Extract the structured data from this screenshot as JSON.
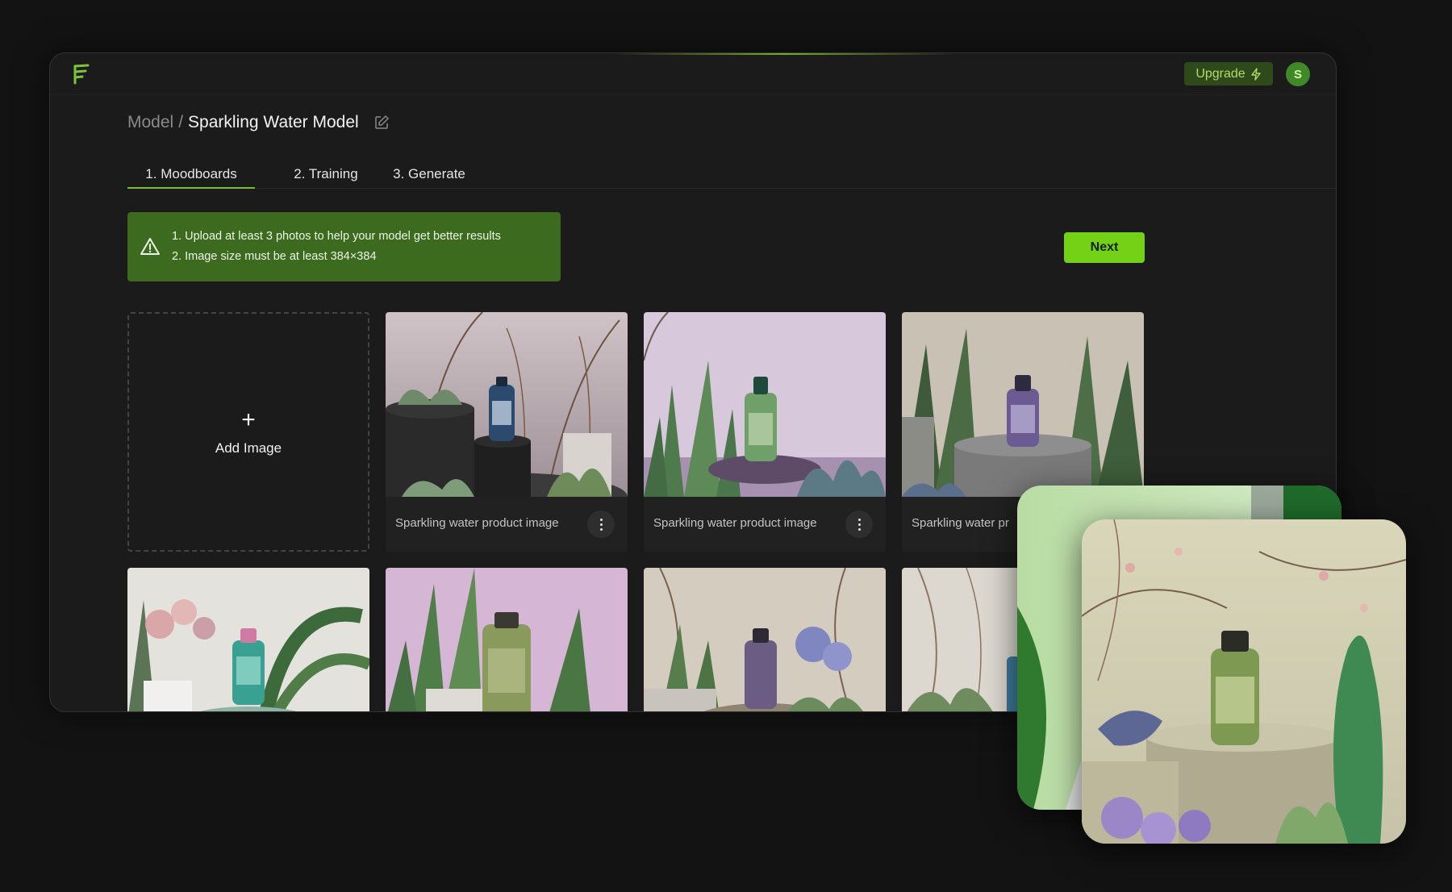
{
  "topbar": {
    "logo_icon": "app-logo-icon",
    "upgrade_label": "Upgrade",
    "upgrade_icon": "lightning-icon",
    "avatar_initial": "S"
  },
  "breadcrumb": {
    "root": "Model",
    "separator": "/",
    "current": "Sparkling Water Model",
    "edit_icon": "edit-icon"
  },
  "tabs": [
    {
      "label": "1. Moodboards",
      "active": true
    },
    {
      "label": "2. Training",
      "active": false
    },
    {
      "label": "3. Generate",
      "active": false
    }
  ],
  "notice": {
    "icon": "warning-icon",
    "lines": [
      "1. Upload at least 3 photos to help your model get better results",
      "2. Image size must be at least 384×384"
    ]
  },
  "actions": {
    "next_label": "Next"
  },
  "gallery": {
    "add_label": "Add Image",
    "add_icon": "plus-icon",
    "images": [
      {
        "caption": "Sparkling water product image"
      },
      {
        "caption": "Sparkling water product image"
      },
      {
        "caption": "Sparkling water pr"
      }
    ],
    "row2_count": 4
  },
  "colors": {
    "accent": "#73d216",
    "notice_bg": "#3c6a1f",
    "upgrade_bg": "#2e4a1a",
    "window_bg": "#1b1b1b",
    "page_bg": "#131313"
  }
}
